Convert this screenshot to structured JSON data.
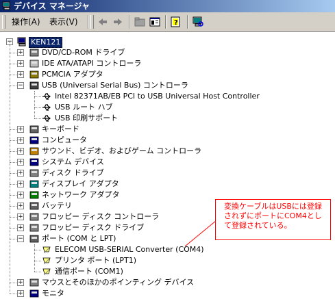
{
  "window": {
    "title": "デバイス マネージャ"
  },
  "menu": {
    "action": "操作(A)",
    "view": "表示(V)"
  },
  "toolbar": {
    "icons": [
      "back-arrow-icon",
      "forward-arrow-icon",
      "folder-view-icon",
      "properties-icon",
      "help-icon",
      "scan-hardware-icon"
    ]
  },
  "tree": {
    "root": "KEN121",
    "items": [
      {
        "label": "DVD/CD-ROM ドライブ",
        "expanded": false
      },
      {
        "label": "IDE ATA/ATAPI コントローラ",
        "expanded": false
      },
      {
        "label": "PCMCIA アダプタ",
        "expanded": false
      },
      {
        "label": "USB (Universal Serial Bus) コントローラ",
        "expanded": true,
        "children": [
          "Intel 82371AB/EB PCI to USB Universal Host Controller",
          "USB ルート ハブ",
          "USB 印刷サポート"
        ]
      },
      {
        "label": "キーボード",
        "expanded": false
      },
      {
        "label": "コンピュータ",
        "expanded": false
      },
      {
        "label": "サウンド、ビデオ、およびゲーム コントローラ",
        "expanded": false
      },
      {
        "label": "システム デバイス",
        "expanded": false
      },
      {
        "label": "ディスク ドライブ",
        "expanded": false
      },
      {
        "label": "ディスプレイ アダプタ",
        "expanded": false
      },
      {
        "label": "ネットワーク アダプタ",
        "expanded": false
      },
      {
        "label": "バッテリ",
        "expanded": false
      },
      {
        "label": "フロッピー ディスク コントローラ",
        "expanded": false
      },
      {
        "label": "フロッピー ディスク ドライブ",
        "expanded": false
      },
      {
        "label": "ポート (COM と LPT)",
        "expanded": true,
        "children": [
          "ELECOM USB-SERIAL Converter (COM4)",
          "プリンタ ポート (LPT1)",
          "通信ポート (COM1)"
        ]
      },
      {
        "label": "マウスとそのほかのポインティング デバイス",
        "expanded": false
      },
      {
        "label": "モニタ",
        "expanded": false
      }
    ]
  },
  "annotation": {
    "text": "変換ケーブルはUSBには登録されずにポートにCOM4として登録されている。"
  },
  "colors": {
    "title_start": "#0a246a",
    "title_end": "#a6caf0",
    "annotation": "#ff0000",
    "chrome": "#d4d0c8"
  }
}
